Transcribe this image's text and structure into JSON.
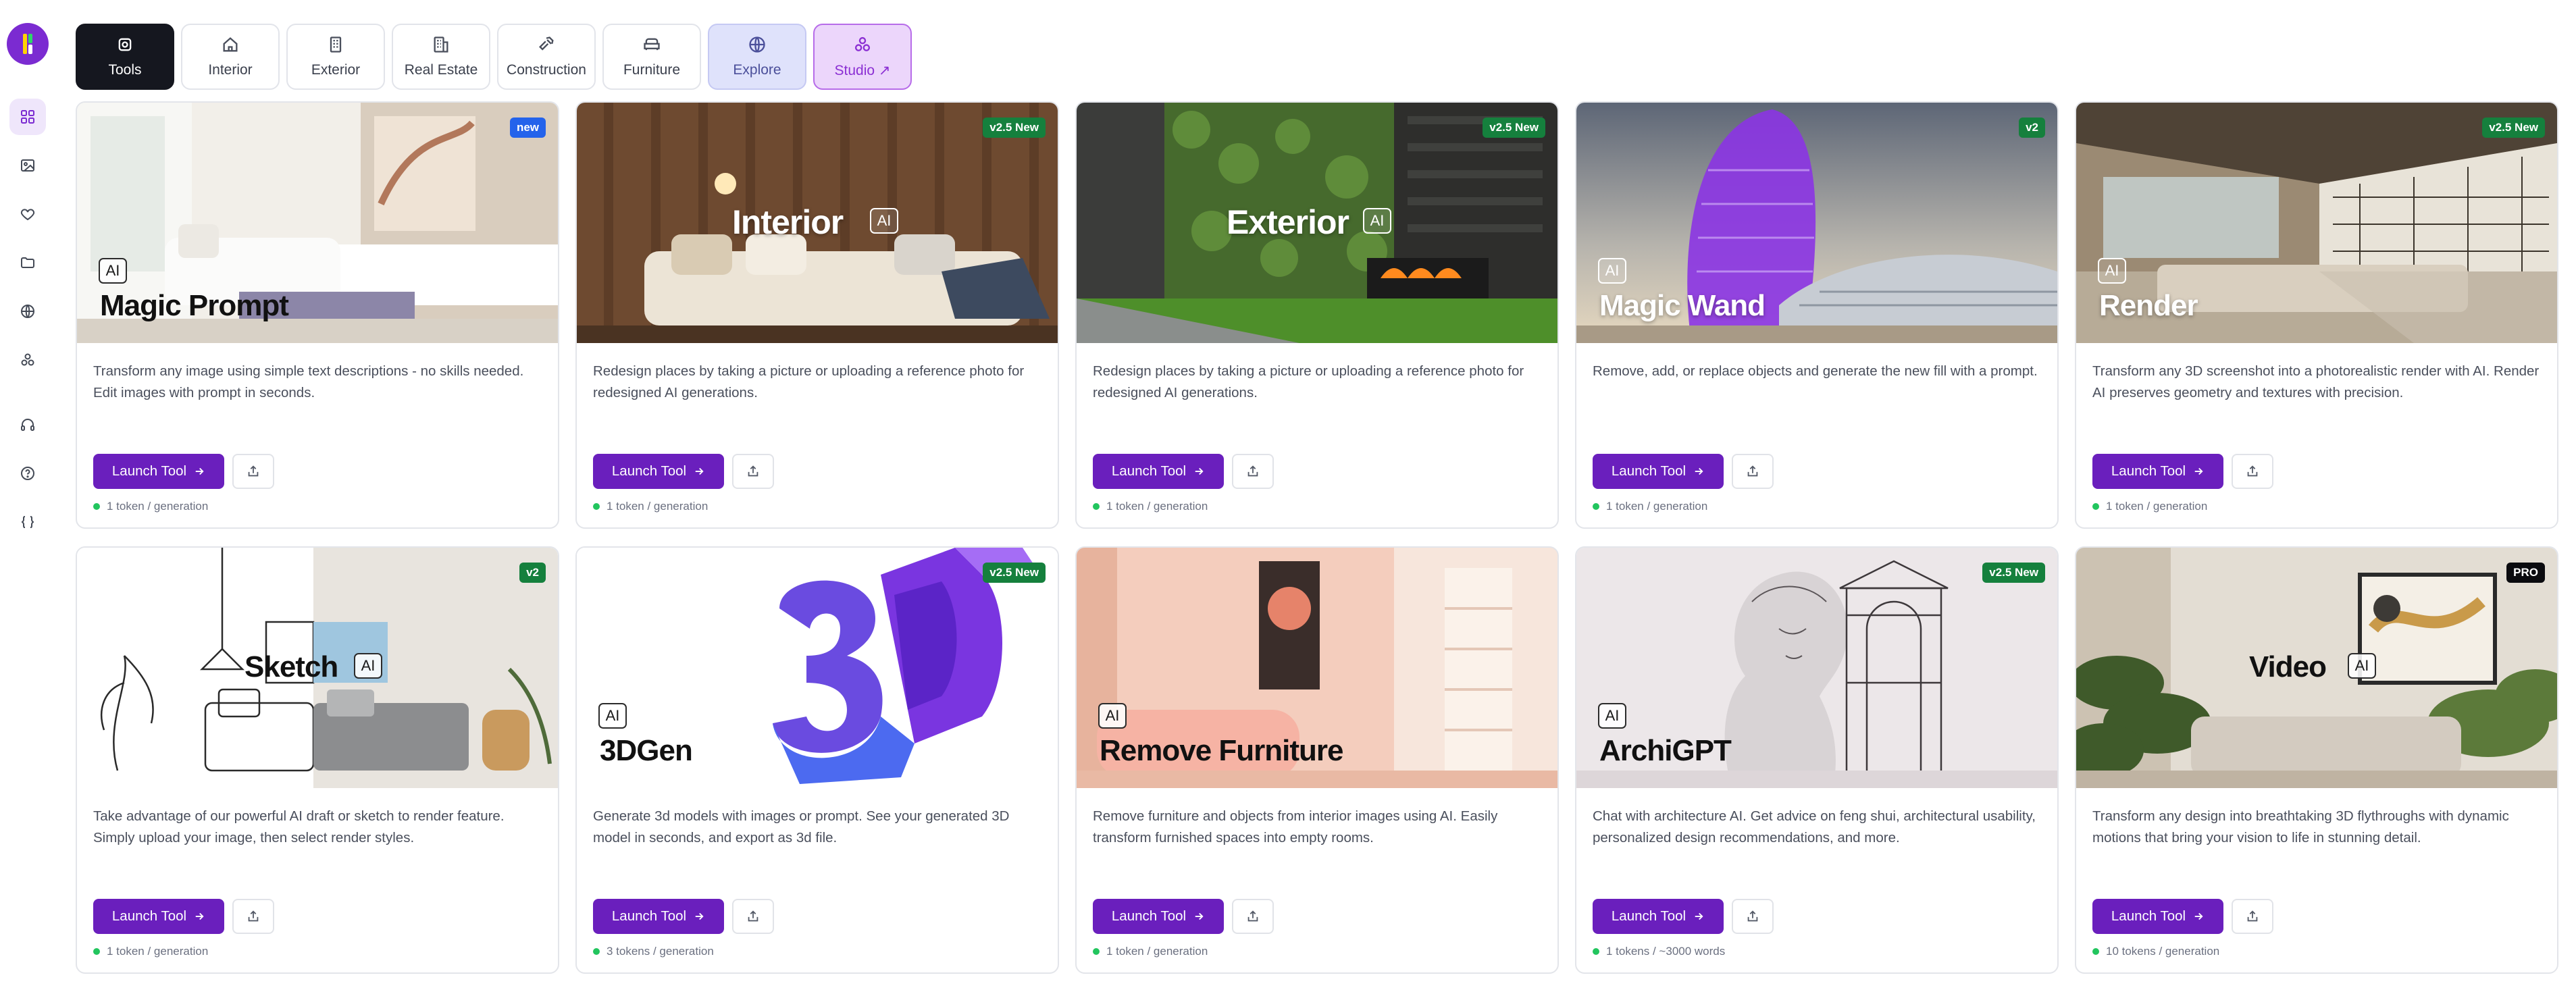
{
  "sidebar": {
    "logo": "logo",
    "items": [
      {
        "icon": "grid-icon",
        "active": true
      },
      {
        "icon": "image-icon"
      },
      {
        "icon": "heart-icon"
      },
      {
        "icon": "folder-icon"
      },
      {
        "icon": "globe-icon"
      },
      {
        "icon": "cubes-icon"
      },
      {
        "icon": "headphones-icon"
      },
      {
        "icon": "help-circle-icon"
      },
      {
        "icon": "braces-icon"
      }
    ]
  },
  "tabs": [
    {
      "label": "Tools",
      "icon": "cube-icon",
      "active": true
    },
    {
      "label": "Interior",
      "icon": "home-icon"
    },
    {
      "label": "Exterior",
      "icon": "building-icon"
    },
    {
      "label": "Real Estate",
      "icon": "office-icon"
    },
    {
      "label": "Construction",
      "icon": "hammer-icon"
    },
    {
      "label": "Furniture",
      "icon": "sofa-icon"
    },
    {
      "label": "Explore",
      "icon": "globe-icon"
    },
    {
      "label": "Studio ↗",
      "icon": "cubes-icon"
    }
  ],
  "common": {
    "ai_label": "AI",
    "launch_label": "Launch Tool",
    "accent": "#6a1fbd",
    "status_dot": "#22c55e"
  },
  "cards": [
    {
      "title": "Magic Prompt",
      "badge": "new",
      "badge_color": "#2463eb",
      "description": "Transform any image using simple text descriptions - no skills needed. Edit images with prompt in seconds.",
      "cost": "1 token / generation"
    },
    {
      "title": "Interior",
      "badge": "v2.5 New",
      "badge_color": "#15803d",
      "description": "Redesign places by taking a picture or uploading a reference photo for redesigned AI generations.",
      "cost": "1 token / generation"
    },
    {
      "title": "Exterior",
      "badge": "v2.5 New",
      "badge_color": "#15803d",
      "description": "Redesign places by taking a picture or uploading a reference photo for redesigned AI generations.",
      "cost": "1 token / generation"
    },
    {
      "title": "Magic Wand",
      "badge": "v2",
      "badge_color": "#15803d",
      "description": "Remove, add, or replace objects and generate the new fill with a prompt.",
      "cost": "1 token / generation"
    },
    {
      "title": "Render",
      "badge": "v2.5 New",
      "badge_color": "#15803d",
      "description": "Transform any 3D screenshot into a photorealistic render with AI. Render AI preserves geometry and textures with precision.",
      "cost": "1 token / generation"
    },
    {
      "title": "Sketch",
      "badge": "v2",
      "badge_color": "#15803d",
      "description": "Take advantage of our powerful AI draft or sketch to render feature. Simply upload your image, then select render styles.",
      "cost": "1 token / generation"
    },
    {
      "title": "3DGen",
      "badge": "v2.5 New",
      "badge_color": "#15803d",
      "description": "Generate 3d models with images or prompt. See your generated 3D model in seconds, and export as 3d file.",
      "cost": "3 tokens / generation"
    },
    {
      "title": "Remove Furniture",
      "badge": "",
      "description": "Remove furniture and objects from interior images using AI. Easily transform furnished spaces into empty rooms.",
      "cost": "1 token / generation"
    },
    {
      "title": "ArchiGPT",
      "badge": "v2.5 New",
      "badge_color": "#15803d",
      "description": "Chat with architecture AI. Get advice on feng shui, architectural usability, personalized design recommendations, and more.",
      "cost": "1 tokens / ~3000 words"
    },
    {
      "title": "Video",
      "badge": "PRO",
      "badge_color": "#0b0b0f",
      "description": "Transform any design into breathtaking 3D flythroughs with dynamic motions that bring your vision to life in stunning detail.",
      "cost": "10 tokens / generation"
    }
  ]
}
